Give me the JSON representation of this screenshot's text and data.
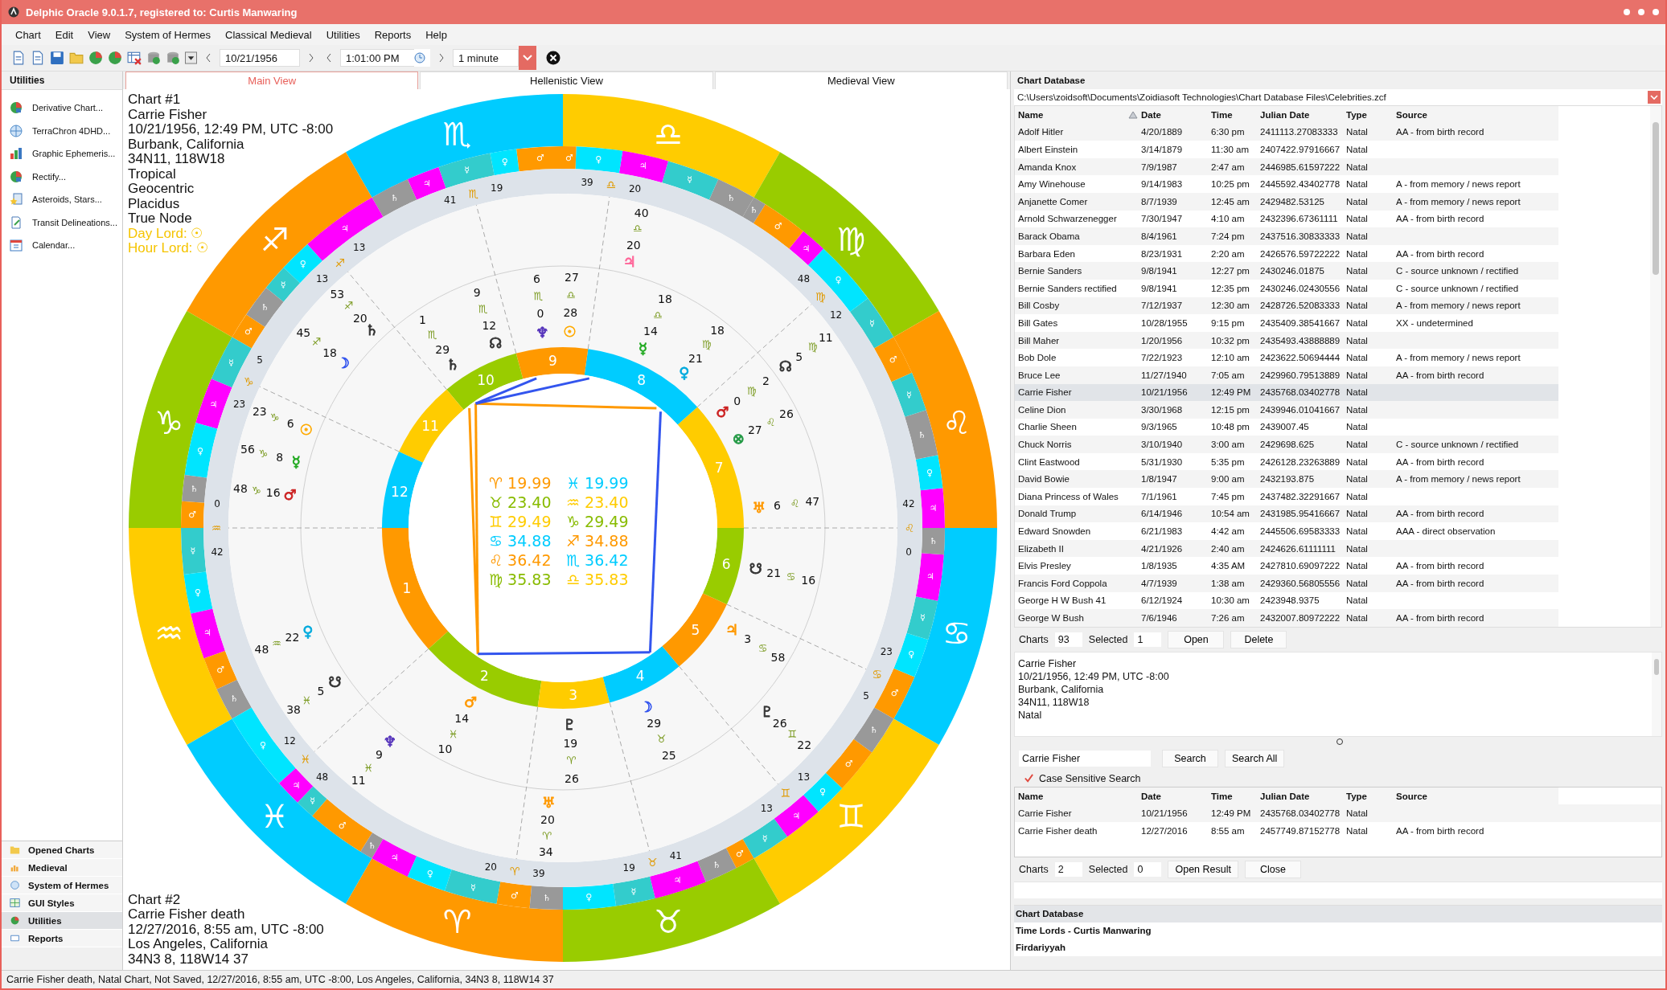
{
  "window": {
    "title": "Delphic Oracle 9.0.1.7, registered to: Curtis Manwaring"
  },
  "menu": [
    "Chart",
    "Edit",
    "View",
    "System of Hermes",
    "Classical Medieval",
    "Utilities",
    "Reports",
    "Help"
  ],
  "toolbar": {
    "date": "10/21/1956",
    "time": "1:01:00 PM",
    "step": "1 minute"
  },
  "sidebar": {
    "title": "Utilities",
    "items": [
      "Derivative Chart...",
      "TerraChron 4DHD...",
      "Graphic Ephemeris...",
      "Rectify...",
      "Asteroids, Stars...",
      "Transit Delineations...",
      "Calendar..."
    ],
    "nav": [
      {
        "label": "Opened Charts",
        "selected": false
      },
      {
        "label": "Medieval",
        "selected": false
      },
      {
        "label": "System of Hermes",
        "selected": false
      },
      {
        "label": "GUI Styles",
        "selected": false
      },
      {
        "label": "Utilities",
        "selected": true
      },
      {
        "label": "Reports",
        "selected": false
      }
    ]
  },
  "tabs": [
    {
      "label": "Main View",
      "selected": true
    },
    {
      "label": "Hellenistic View",
      "selected": false
    },
    {
      "label": "Medieval View",
      "selected": false
    }
  ],
  "chart": {
    "chart_1": {
      "lines": [
        "Chart #1",
        "Carrie Fisher",
        "10/21/1956, 12:49 PM, UTC -8:00",
        "Burbank, California",
        "34N11, 118W18",
        "Tropical",
        "Geocentric",
        "Placidus",
        "True Node"
      ],
      "lords": [
        "Day Lord: ☉",
        "Hour Lord: ☉"
      ]
    },
    "chart_2": {
      "lines": [
        "Chart #2",
        "Carrie Fisher death",
        "12/27/2016, 8:55 am, UTC -8:00",
        "Los Angeles, California",
        "34N3 8, 118W14 37"
      ]
    },
    "signs": [
      {
        "glyph": "♏",
        "color": "#00ccff",
        "terms": [
          {
            "glyph": "♂",
            "color": "#ff9900"
          },
          {
            "glyph": "♀",
            "color": "#00e5ff"
          },
          {
            "glyph": "☿",
            "color": "#33cccc"
          },
          {
            "glyph": "♃",
            "color": "#ff00ff"
          },
          {
            "glyph": "♄",
            "color": "#999999"
          }
        ]
      },
      {
        "glyph": "♎",
        "color": "#ffcc00",
        "terms": [
          {
            "glyph": "♄",
            "color": "#999999"
          },
          {
            "glyph": "☿",
            "color": "#33cccc"
          },
          {
            "glyph": "♃",
            "color": "#ff00ff"
          },
          {
            "glyph": "♀",
            "color": "#00e5ff"
          },
          {
            "glyph": "♂",
            "color": "#ff9900"
          }
        ]
      },
      {
        "glyph": "♐",
        "color": "#ff9900",
        "terms": [
          {
            "glyph": "♃",
            "color": "#ff00ff"
          },
          {
            "glyph": "♀",
            "color": "#00e5ff"
          },
          {
            "glyph": "☿",
            "color": "#33cccc"
          },
          {
            "glyph": "♄",
            "color": "#999999"
          },
          {
            "glyph": "♂",
            "color": "#ff9900"
          }
        ]
      },
      {
        "glyph": "♍",
        "color": "#99cc00",
        "terms": [
          {
            "glyph": "☿",
            "color": "#33cccc"
          },
          {
            "glyph": "♀",
            "color": "#00e5ff"
          },
          {
            "glyph": "♃",
            "color": "#ff00ff"
          },
          {
            "glyph": "♂",
            "color": "#ff9900"
          },
          {
            "glyph": "♄",
            "color": "#999999"
          }
        ]
      },
      {
        "glyph": "♑",
        "color": "#99cc00",
        "terms": [
          {
            "glyph": "☿",
            "color": "#33cccc"
          },
          {
            "glyph": "♃",
            "color": "#ff00ff"
          },
          {
            "glyph": "♀",
            "color": "#00e5ff"
          },
          {
            "glyph": "♄",
            "color": "#999999"
          },
          {
            "glyph": "♂",
            "color": "#ff9900"
          }
        ]
      },
      {
        "glyph": "♌",
        "color": "#ff9900",
        "terms": [
          {
            "glyph": "♃",
            "color": "#ff00ff"
          },
          {
            "glyph": "♀",
            "color": "#00e5ff"
          },
          {
            "glyph": "♄",
            "color": "#999999"
          },
          {
            "glyph": "☿",
            "color": "#33cccc"
          },
          {
            "glyph": "♂",
            "color": "#ff9900"
          }
        ]
      },
      {
        "glyph": "♒",
        "color": "#ffcc00",
        "terms": [
          {
            "glyph": "☿",
            "color": "#33cccc"
          },
          {
            "glyph": "♀",
            "color": "#00e5ff"
          },
          {
            "glyph": "♃",
            "color": "#ff00ff"
          },
          {
            "glyph": "♂",
            "color": "#ff9900"
          },
          {
            "glyph": "♄",
            "color": "#999999"
          }
        ]
      },
      {
        "glyph": "♋",
        "color": "#00ccff",
        "terms": [
          {
            "glyph": "♂",
            "color": "#ff9900"
          },
          {
            "glyph": "♀",
            "color": "#00e5ff"
          },
          {
            "glyph": "☿",
            "color": "#33cccc"
          },
          {
            "glyph": "♃",
            "color": "#ff00ff"
          },
          {
            "glyph": "♄",
            "color": "#999999"
          }
        ]
      },
      {
        "glyph": "♓",
        "color": "#00ccff",
        "terms": [
          {
            "glyph": "♀",
            "color": "#00e5ff"
          },
          {
            "glyph": "♃",
            "color": "#ff00ff"
          },
          {
            "glyph": "☿",
            "color": "#33cccc"
          },
          {
            "glyph": "♂",
            "color": "#ff9900"
          },
          {
            "glyph": "♄",
            "color": "#999999"
          }
        ]
      },
      {
        "glyph": "♊",
        "color": "#ffcc00",
        "terms": [
          {
            "glyph": "☿",
            "color": "#33cccc"
          },
          {
            "glyph": "♃",
            "color": "#ff00ff"
          },
          {
            "glyph": "♀",
            "color": "#00e5ff"
          },
          {
            "glyph": "♂",
            "color": "#ff9900"
          },
          {
            "glyph": "♄",
            "color": "#999999"
          }
        ]
      },
      {
        "glyph": "♈",
        "color": "#ff9900",
        "terms": [
          {
            "glyph": "♃",
            "color": "#ff00ff"
          },
          {
            "glyph": "♀",
            "color": "#00e5ff"
          },
          {
            "glyph": "☿",
            "color": "#33cccc"
          },
          {
            "glyph": "♂",
            "color": "#ff9900"
          },
          {
            "glyph": "♄",
            "color": "#999999"
          }
        ]
      },
      {
        "glyph": "♉",
        "color": "#99cc00",
        "terms": [
          {
            "glyph": "♀",
            "color": "#00e5ff"
          },
          {
            "glyph": "☿",
            "color": "#33cccc"
          },
          {
            "glyph": "♃",
            "color": "#ff00ff"
          },
          {
            "glyph": "♄",
            "color": "#999999"
          },
          {
            "glyph": "♂",
            "color": "#ff9900"
          }
        ]
      }
    ],
    "houses": [
      {
        "number": "1",
        "color": "#ff9900"
      },
      {
        "number": "2",
        "color": "#99cc00"
      },
      {
        "number": "3",
        "color": "#ffcc00"
      },
      {
        "number": "4",
        "color": "#00ccff"
      },
      {
        "number": "5",
        "color": "#ff9900"
      },
      {
        "number": "6",
        "color": "#99cc00"
      },
      {
        "number": "7",
        "color": "#ffcc00"
      },
      {
        "number": "8",
        "color": "#00ccff"
      },
      {
        "number": "9",
        "color": "#ff9900"
      },
      {
        "number": "10",
        "color": "#99cc00"
      },
      {
        "number": "11",
        "color": "#ffcc00"
      },
      {
        "number": "12",
        "color": "#00ccff"
      }
    ],
    "cusps": [
      {
        "degree": "0",
        "sign": "♒",
        "minute": "42"
      },
      {
        "degree": "12",
        "sign": "♓",
        "minute": "48"
      },
      {
        "degree": "20",
        "sign": "♈",
        "minute": "39"
      },
      {
        "degree": "19",
        "sign": "♉",
        "minute": "41"
      },
      {
        "degree": "13",
        "sign": "♊",
        "minute": "13"
      },
      {
        "degree": "5",
        "sign": "♋",
        "minute": "23"
      },
      {
        "degree": "0",
        "sign": "♌",
        "minute": "42"
      },
      {
        "degree": "12",
        "sign": "♍",
        "minute": "48"
      },
      {
        "degree": "20",
        "sign": "♎",
        "minute": "39"
      },
      {
        "degree": "19",
        "sign": "♏",
        "minute": "41"
      },
      {
        "degree": "13",
        "sign": "♐",
        "minute": "13"
      },
      {
        "degree": "5",
        "sign": "♑",
        "minute": "23"
      }
    ],
    "inner_planets": [
      {
        "glyph": "♆",
        "degree": "0",
        "sign": "♏",
        "minute": "6",
        "color": "#5533bb"
      },
      {
        "glyph": "☉",
        "degree": "28",
        "sign": "♎",
        "minute": "27",
        "color": "#ffaa00"
      },
      {
        "glyph": "☊",
        "degree": "12",
        "sign": "♏",
        "minute": "9",
        "color": "#333333"
      },
      {
        "glyph": "☿",
        "degree": "14",
        "sign": "♎",
        "minute": "18",
        "color": "#22aa22"
      },
      {
        "glyph": "♄",
        "degree": "29",
        "sign": "♏",
        "minute": "1",
        "color": "#333333"
      },
      {
        "glyph": "♀",
        "degree": "21",
        "sign": "♍",
        "minute": "18",
        "color": "#00aadd"
      },
      {
        "glyph": "♂",
        "degree": "0",
        "sign": "♍",
        "minute": "2",
        "color": "#cc2222"
      },
      {
        "glyph": "⊗",
        "degree": "27",
        "sign": "♌",
        "minute": "26",
        "color": "#229944"
      },
      {
        "glyph": "♅",
        "degree": "6",
        "sign": "♌",
        "minute": "47",
        "color": "#ff9900"
      },
      {
        "glyph": "☋",
        "degree": "21",
        "sign": "♋",
        "minute": "16",
        "color": "#333333"
      },
      {
        "glyph": "♃",
        "degree": "3",
        "sign": "♋",
        "minute": "58",
        "color": "#ff9900"
      },
      {
        "glyph": "♂",
        "degree": "14",
        "sign": "♓",
        "minute": "10",
        "color": "#ff9900"
      },
      {
        "glyph": "☽",
        "degree": "29",
        "sign": "♉",
        "minute": "25",
        "color": "#3355ee"
      },
      {
        "glyph": "♇",
        "degree": "19",
        "sign": "♈",
        "minute": "26",
        "color": "#333333"
      }
    ],
    "outer_planets": [
      {
        "glyph": "☊",
        "degree": "5",
        "sign": "♍",
        "minute": "11",
        "color": "#333333"
      },
      {
        "glyph": "♃",
        "degree": "20",
        "sign": "♎",
        "minute": "40",
        "color": "#ff6699"
      },
      {
        "glyph": "♄",
        "degree": "20",
        "sign": "♐",
        "minute": "53",
        "color": "#333333"
      },
      {
        "glyph": "☽",
        "degree": "18",
        "sign": "♐",
        "minute": "45",
        "color": "#3355ee"
      },
      {
        "glyph": "☉",
        "degree": "6",
        "sign": "♑",
        "minute": "23",
        "color": "#ffaa00"
      },
      {
        "glyph": "☿",
        "degree": "8",
        "sign": "♑",
        "minute": "56",
        "color": "#22aa22"
      },
      {
        "glyph": "♂",
        "degree": "16",
        "sign": "♑",
        "minute": "48",
        "color": "#cc2222"
      },
      {
        "glyph": "♀",
        "degree": "22",
        "sign": "♒",
        "minute": "48",
        "color": "#00aadd"
      },
      {
        "glyph": "☋",
        "degree": "5",
        "sign": "♓",
        "minute": "38",
        "color": "#333333"
      },
      {
        "glyph": "♆",
        "degree": "9",
        "sign": "♓",
        "minute": "11",
        "color": "#5533bb"
      },
      {
        "glyph": "♅",
        "degree": "20",
        "sign": "♈",
        "minute": "34",
        "color": "#ff9900"
      },
      {
        "glyph": "♇",
        "degree": "26",
        "sign": "♊",
        "minute": "22",
        "color": "#333333"
      }
    ],
    "sign_table": [
      {
        "text": "♈ 19.99",
        "color": "#ff9900"
      },
      {
        "text": "♓ 19.99",
        "color": "#00ccff"
      },
      {
        "text": "♉ 23.40",
        "color": "#88bb00"
      },
      {
        "text": "♒ 23.40",
        "color": "#ffcc00"
      },
      {
        "text": "♊ 29.49",
        "color": "#ffcc00"
      },
      {
        "text": "♑ 29.49",
        "color": "#88bb00"
      },
      {
        "text": "♋ 34.88",
        "color": "#00ccff"
      },
      {
        "text": "♐ 34.88",
        "color": "#ff9900"
      },
      {
        "text": "♌ 36.42",
        "color": "#ff9900"
      },
      {
        "text": "♏ 36.42",
        "color": "#00ccff"
      },
      {
        "text": "♍ 35.83",
        "color": "#88bb00"
      },
      {
        "text": "♎ 35.83",
        "color": "#ffcc00"
      }
    ]
  },
  "database": {
    "title": "Chart Database",
    "path": "C:\\Users\\zoidsoft\\Documents\\Zoidiasoft Technologies\\Chart Database Files\\Celebrities.zcf",
    "columns": [
      "Name",
      "Date",
      "Time",
      "Julian Date",
      "Type",
      "Source"
    ],
    "rows": [
      {
        "name": "Adolf Hitler",
        "date": "4/20/1889",
        "time": "6:30 pm",
        "julian": "2411113.27083333",
        "type": "Natal",
        "source": "AA - from birth record",
        "selected": false
      },
      {
        "name": "Albert Einstein",
        "date": "3/14/1879",
        "time": "11:30 am",
        "julian": "2407422.97916667",
        "type": "Natal",
        "selected": false
      },
      {
        "name": "Amanda Knox",
        "date": "7/9/1987",
        "time": "2:47 am",
        "julian": "2446985.61597222",
        "type": "Natal",
        "selected": false
      },
      {
        "name": "Amy Winehouse",
        "date": "9/14/1983",
        "time": "10:25 pm",
        "julian": "2445592.43402778",
        "type": "Natal",
        "source": "A - from memory / news report",
        "selected": false
      },
      {
        "name": "Anjanette Comer",
        "date": "8/7/1939",
        "time": "12:45 am",
        "julian": "2429482.53125",
        "type": "Natal",
        "source": "A - from memory / news report",
        "selected": false
      },
      {
        "name": "Arnold Schwarzenegger",
        "date": "7/30/1947",
        "time": "4:10 am",
        "julian": "2432396.67361111",
        "type": "Natal",
        "source": "AA - from birth record",
        "selected": false
      },
      {
        "name": "Barack Obama",
        "date": "8/4/1961",
        "time": "7:24 pm",
        "julian": "2437516.30833333",
        "type": "Natal",
        "selected": false
      },
      {
        "name": "Barbara Eden",
        "date": "8/23/1931",
        "time": "2:20 am",
        "julian": "2426576.59722222",
        "type": "Natal",
        "source": "AA - from birth record",
        "selected": false
      },
      {
        "name": "Bernie Sanders",
        "date": "9/8/1941",
        "time": "12:27 pm",
        "julian": "2430246.01875",
        "type": "Natal",
        "source": "C - source unknown / rectified",
        "selected": false
      },
      {
        "name": "Bernie Sanders rectified",
        "date": "9/8/1941",
        "time": "12:35 pm",
        "julian": "2430246.02430556",
        "type": "Natal",
        "source": "C - source unknown / rectified",
        "selected": false
      },
      {
        "name": "Bill Cosby",
        "date": "7/12/1937",
        "time": "12:30 am",
        "julian": "2428726.52083333",
        "type": "Natal",
        "source": "A - from memory / news report",
        "selected": false
      },
      {
        "name": "Bill Gates",
        "date": "10/28/1955",
        "time": "9:15 pm",
        "julian": "2435409.38541667",
        "type": "Natal",
        "source": "XX - undetermined",
        "selected": false
      },
      {
        "name": "Bill Maher",
        "date": "1/20/1956",
        "time": "10:32 pm",
        "julian": "2435493.43888889",
        "type": "Natal",
        "selected": false
      },
      {
        "name": "Bob Dole",
        "date": "7/22/1923",
        "time": "12:10 am",
        "julian": "2423622.50694444",
        "type": "Natal",
        "source": "A - from memory / news report",
        "selected": false
      },
      {
        "name": "Bruce Lee",
        "date": "11/27/1940",
        "time": "7:05 am",
        "julian": "2429960.79513889",
        "type": "Natal",
        "source": "AA - from birth record",
        "selected": false
      },
      {
        "name": "Carrie Fisher",
        "date": "10/21/1956",
        "time": "12:49 PM",
        "julian": "2435768.03402778",
        "type": "Natal",
        "selected": true
      },
      {
        "name": "Celine Dion",
        "date": "3/30/1968",
        "time": "12:15 pm",
        "julian": "2439946.01041667",
        "type": "Natal",
        "selected": false
      },
      {
        "name": "Charlie Sheen",
        "date": "9/3/1965",
        "time": "10:48 pm",
        "julian": "2439007.45",
        "type": "Natal",
        "selected": false
      },
      {
        "name": "Chuck Norris",
        "date": "3/10/1940",
        "time": "3:00 am",
        "julian": "2429698.625",
        "type": "Natal",
        "source": "C - source unknown / rectified",
        "selected": false
      },
      {
        "name": "Clint Eastwood",
        "date": "5/31/1930",
        "time": "5:35 pm",
        "julian": "2426128.23263889",
        "type": "Natal",
        "source": "AA - from birth record",
        "selected": false
      },
      {
        "name": "David Bowie",
        "date": "1/8/1947",
        "time": "9:00 am",
        "julian": "2432193.875",
        "type": "Natal",
        "source": "A - from memory / news report",
        "selected": false
      },
      {
        "name": "Diana Princess of Wales",
        "date": "7/1/1961",
        "time": "7:45 pm",
        "julian": "2437482.32291667",
        "type": "Natal",
        "selected": false
      },
      {
        "name": "Donald Trump",
        "date": "6/14/1946",
        "time": "10:54 am",
        "julian": "2431985.95416667",
        "type": "Natal",
        "source": "AA - from birth record",
        "selected": false
      },
      {
        "name": "Edward Snowden",
        "date": "6/21/1983",
        "time": "4:42 am",
        "julian": "2445506.69583333",
        "type": "Natal",
        "source": "AAA - direct observation",
        "selected": false
      },
      {
        "name": "Elizabeth II",
        "date": "4/21/1926",
        "time": "2:40 am",
        "julian": "2424626.61111111",
        "type": "Natal",
        "selected": false
      },
      {
        "name": "Elvis Presley",
        "date": "1/8/1935",
        "time": "4:35 AM",
        "julian": "2427810.69097222",
        "type": "Natal",
        "source": "AA - from birth record",
        "selected": false
      },
      {
        "name": "Francis Ford Coppola",
        "date": "4/7/1939",
        "time": "1:38 am",
        "julian": "2429360.56805556",
        "type": "Natal",
        "source": "AA - from birth record",
        "selected": false
      },
      {
        "name": "George H W Bush 41",
        "date": "6/12/1924",
        "time": "10:30 am",
        "julian": "2423948.9375",
        "type": "Natal",
        "selected": false
      },
      {
        "name": "George W Bush",
        "date": "7/6/1946",
        "time": "7:26 am",
        "julian": "2432007.80972222",
        "type": "Natal",
        "source": "AA - from birth record",
        "selected": false
      }
    ],
    "charts_label": "Charts",
    "charts": "93",
    "selected_label": "Selected",
    "selected": "1",
    "buttons": [
      "Open",
      "Delete"
    ],
    "notes": [
      "Carrie Fisher",
      "10/21/1956, 12:49 PM, UTC -8:00",
      "Burbank, California",
      "34N11, 118W18",
      "Natal"
    ],
    "search": {
      "value": "Carrie Fisher",
      "buttons": [
        "Search",
        "Search All"
      ],
      "case_label": "Case Sensitive Search",
      "case_sensitive": true
    },
    "results": [
      {
        "name": "Carrie Fisher",
        "date": "10/21/1956",
        "time": "12:49 PM",
        "julian": "2435768.03402778",
        "type": "Natal",
        "selected": false
      },
      {
        "name": "Carrie Fisher death",
        "date": "12/27/2016",
        "time": "8:55 am",
        "julian": "2457749.87152778",
        "type": "Natal",
        "source": "AA - from birth record",
        "selected": false
      }
    ],
    "result_columns": [
      "Name",
      "Date",
      "Time",
      "Julian Date",
      "Type",
      "Source"
    ],
    "result_charts_label": "Charts",
    "result_charts": "2",
    "result_selected_label": "Selected",
    "result_selected": "0",
    "result_buttons": [
      "Open Result",
      "Close"
    ],
    "nav": [
      {
        "label": "Chart Database",
        "selected": true
      },
      {
        "label": "Time Lords - Curtis Manwaring",
        "selected": false
      },
      {
        "label": "Firdariyyah",
        "selected": false
      }
    ]
  },
  "status_bar": "Carrie Fisher death, Natal Chart, Not Saved, 12/27/2016, 8:55 am, UTC -8:00, Los Angeles, California, 34N3 8, 118W14 37"
}
